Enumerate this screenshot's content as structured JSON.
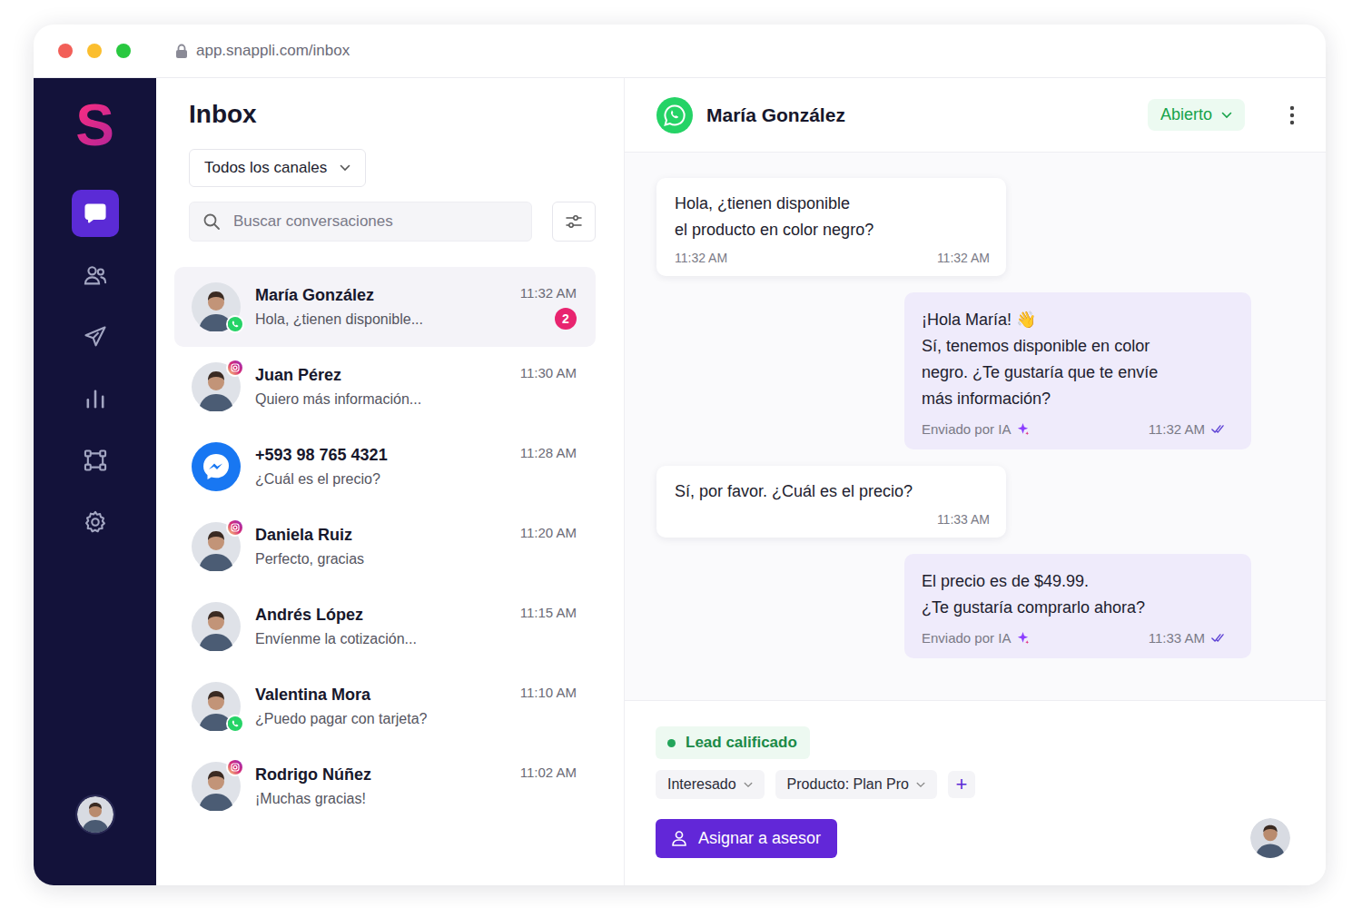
{
  "browser": {
    "url": "app.snappli.com/inbox"
  },
  "logo": "S",
  "sidebar": {
    "items": [
      {
        "selected": true
      },
      {
        "selected": false
      },
      {
        "selected": false
      },
      {
        "selected": false
      },
      {
        "selected": false
      },
      {
        "selected": false
      }
    ]
  },
  "inbox": {
    "title": "Inbox",
    "channel_filter": "Todos los canales",
    "search": {
      "placeholder": "Buscar conversaciones"
    },
    "conversations": [
      {
        "name": "María González",
        "preview": "Hola, ¿tienen disponible...",
        "time": "11:32 AM",
        "channel": "whatsapp",
        "unread": "2",
        "selected": true
      },
      {
        "name": "Juan Pérez",
        "preview": "Quiero más información...",
        "time": "11:30 AM",
        "channel": "instagram",
        "selected": false
      },
      {
        "name": "+593 98 765 4321",
        "preview": "¿Cuál es el precio?",
        "time": "11:28 AM",
        "channel": "messenger",
        "selected": false
      },
      {
        "name": "Daniela Ruiz",
        "preview": "Perfecto, gracias",
        "time": "11:20 AM",
        "channel": "instagram",
        "selected": false
      },
      {
        "name": "Andrés López",
        "preview": "Envíenme la cotización...",
        "time": "11:15 AM",
        "channel": "none",
        "selected": false
      },
      {
        "name": "Valentina Mora",
        "preview": "¿Puedo pagar con tarjeta?",
        "time": "11:10 AM",
        "channel": "whatsapp",
        "selected": false
      },
      {
        "name": "Rodrigo Núñez",
        "preview": "¡Muchas gracias!",
        "time": "11:02 AM",
        "channel": "instagram",
        "selected": false
      }
    ]
  },
  "chat": {
    "contact": "María González",
    "channel": "whatsapp",
    "status": "Abierto",
    "messages": [
      {
        "kind": "incoming",
        "lines": [
          "Hola, ¿tienen disponible",
          "el producto en color negro?"
        ],
        "time_left": "11:32 AM",
        "time": "11:32 AM"
      },
      {
        "kind": "outgoing",
        "lines": [
          "¡Hola María! 👋",
          "Sí, tenemos disponible en color",
          "negro. ¿Te gustaría que te envíe",
          "más información?"
        ],
        "sender": "Enviado por IA",
        "time": "11:32 AM",
        "read": true
      },
      {
        "kind": "incoming",
        "lines": [
          "Sí, por favor. ¿Cuál es el precio?"
        ],
        "time": "11:33 AM"
      },
      {
        "kind": "outgoing",
        "lines": [
          "El precio es de $49.99.",
          "¿Te gustaría comprarlo ahora?"
        ],
        "sender": "Enviado por IA",
        "time": "11:33 AM",
        "read": true
      }
    ]
  },
  "footer": {
    "tag": {
      "label": "Lead calificado",
      "color": "#22a55a"
    },
    "chips": [
      {
        "label": "Interesado"
      },
      {
        "label": "Producto: Plan Pro"
      }
    ],
    "add": "+",
    "assign_button": "Asignar a asesor"
  }
}
